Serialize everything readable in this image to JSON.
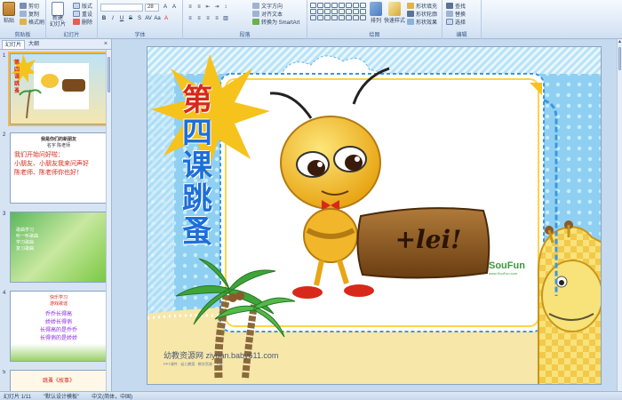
{
  "ribbon": {
    "clipboard": {
      "paste": "粘贴",
      "cut": "剪切",
      "copy": "复制",
      "format_painter": "格式刷",
      "label": "剪贴板"
    },
    "slides": {
      "new_slide": "新建\n幻灯片",
      "layout": "版式",
      "reset": "重设",
      "delete": "删除",
      "label": "幻灯片"
    },
    "font": {
      "font_name": "",
      "font_size": "28",
      "label": "字体",
      "bold": "B",
      "italic": "I",
      "underline": "U",
      "strike": "S",
      "shadow": "S",
      "spacing": "AV",
      "case": "Aa",
      "color": "A"
    },
    "paragraph": {
      "text_direction": "文字方向",
      "align_text": "对齐文本",
      "smartart": "转换为 SmartArt",
      "label": "段落"
    },
    "drawing": {
      "arrange": "排列",
      "quick_styles": "快速样式",
      "fill": "形状填充",
      "outline": "形状轮廓",
      "effects": "形状效果",
      "label": "绘图"
    },
    "editing": {
      "find": "查找",
      "replace": "替换",
      "select": "选择",
      "label": "编辑"
    }
  },
  "left_pane": {
    "tabs": [
      "幻灯片",
      "大纲"
    ],
    "close": "×",
    "slides": [
      {
        "num": "1",
        "title": "第四课跳蚤"
      },
      {
        "num": "2",
        "lines": [
          "我是你们的新朋友",
          "名字 陈老师",
          "我们开始问好啦：",
          "小朋友、小朋友我来问声好",
          "陈老师、陈老师你也好！"
        ]
      },
      {
        "num": "3",
        "lines": [
          "歌曲学习",
          "听一听歌曲",
          "学习歌曲",
          "复习歌曲"
        ]
      },
      {
        "num": "4",
        "lines": [
          "快乐学习",
          "游戏歌谣",
          "乔乔长得高",
          "娇娇长得俏",
          "长得高的是乔乔",
          "长得俏的是娇娇"
        ]
      },
      {
        "num": "5",
        "lines": [
          "跳蚤《故事》"
        ]
      }
    ]
  },
  "slide": {
    "title_chars": [
      "第",
      "四",
      "课",
      "跳",
      "蚤"
    ],
    "sign_text": "+lei!",
    "brand": "SouFun",
    "brand_sub": "www.SouFun.com",
    "watermark": "幼教资源网 ziyuan.baby611.com",
    "watermark_sub": "PPT课件 · 幼儿教案 · 教学资源 · 下载"
  },
  "status": {
    "slide_info": "幻灯片 1/11",
    "theme": "\"默认设计模板\"",
    "language": "中文(简体，中国)"
  },
  "colors": {
    "ribbon_text": "#2a3f60",
    "title_blue": "#1d6fd8",
    "title_red": "#d8281c",
    "sky": "#8ccdf0",
    "sand": "#f7e7a9"
  }
}
